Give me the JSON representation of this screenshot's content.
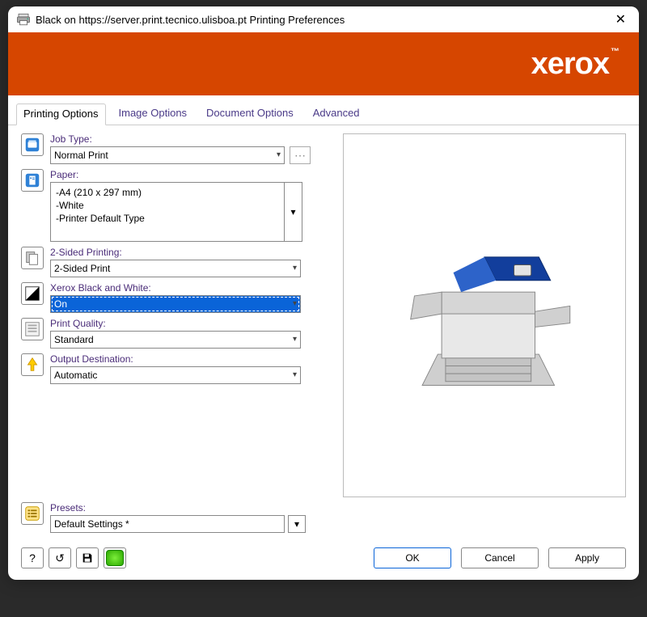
{
  "window": {
    "title": "Black on https://server.print.tecnico.ulisboa.pt Printing Preferences"
  },
  "banner": {
    "brand": "xerox",
    "tm": "™"
  },
  "tabs": [
    {
      "label": "Printing Options",
      "active": true
    },
    {
      "label": "Image Options",
      "active": false
    },
    {
      "label": "Document Options",
      "active": false
    },
    {
      "label": "Advanced",
      "active": false
    }
  ],
  "settings": {
    "job_type": {
      "label": "Job Type:",
      "value": "Normal Print"
    },
    "paper": {
      "label": "Paper:",
      "line1": "-A4 (210 x 297 mm)",
      "line2": "-White",
      "line3": "-Printer Default Type"
    },
    "duplex": {
      "label": "2-Sided Printing:",
      "value": "2-Sided Print"
    },
    "bw": {
      "label": "Xerox Black and White:",
      "value": "On"
    },
    "quality": {
      "label": "Print Quality:",
      "value": "Standard"
    },
    "output": {
      "label": "Output Destination:",
      "value": "Automatic"
    }
  },
  "presets": {
    "label": "Presets:",
    "value": "Default Settings *"
  },
  "buttons": {
    "help": "?",
    "reset": "↺",
    "save": "💾",
    "eco": "",
    "ok": "OK",
    "cancel": "Cancel",
    "apply": "Apply"
  }
}
